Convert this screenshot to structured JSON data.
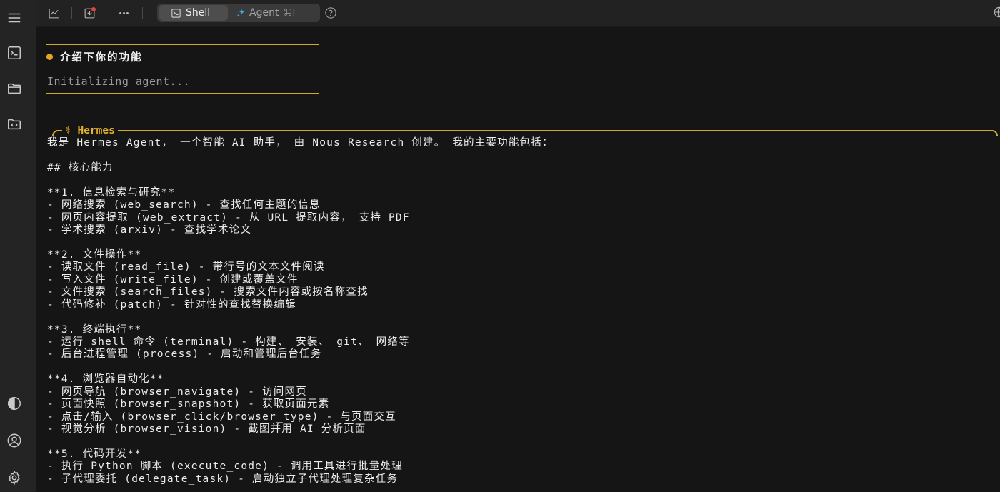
{
  "topbar": {
    "shell_label": "Shell",
    "agent_label": "Agent",
    "agent_shortcut": "⌘I"
  },
  "terminal": {
    "prompt": "介绍下你的功能",
    "status": "Initializing agent...",
    "agent_name": "⚕ Hermes",
    "lines": [
      "我是 Hermes Agent， 一个智能 AI 助手， 由 Nous Research 创建。 我的主要功能包括：",
      "",
      "## 核心能力",
      "",
      "**1. 信息检索与研究**",
      "- 网络搜索 (web_search) - 查找任何主题的信息",
      "- 网页内容提取 (web_extract) - 从 URL 提取内容， 支持 PDF",
      "- 学术搜索 (arxiv) - 查找学术论文",
      "",
      "**2. 文件操作**",
      "- 读取文件 (read_file) - 带行号的文本文件阅读",
      "- 写入文件 (write_file) - 创建或覆盖文件",
      "- 文件搜索 (search_files) - 搜索文件内容或按名称查找",
      "- 代码修补 (patch) - 针对性的查找替换编辑",
      "",
      "**3. 终端执行**",
      "- 运行 shell 命令 (terminal) - 构建、 安装、 git、 网络等",
      "- 后台进程管理 (process) - 启动和管理后台任务",
      "",
      "**4. 浏览器自动化**",
      "- 网页导航 (browser_navigate) - 访问网页",
      "- 页面快照 (browser_snapshot) - 获取页面元素",
      "- 点击/输入 (browser_click/browser_type) - 与页面交互",
      "- 视觉分析 (browser_vision) - 截图并用 AI 分析页面",
      "",
      "**5. 代码开发**",
      "- 执行 Python 脚本 (execute_code) - 调用工具进行批量处理",
      "- 子代理委托 (delegate_task) - 启动独立子代理处理复杂任务"
    ]
  },
  "colors": {
    "accent": "#d4a72c",
    "background": "#151515",
    "rail": "#242424"
  }
}
